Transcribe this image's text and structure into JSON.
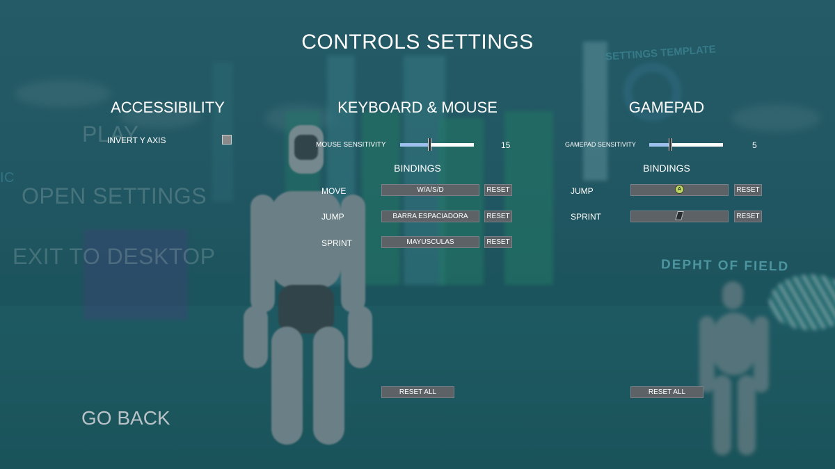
{
  "title": "CONTROLS SETTINGS",
  "background_menu": {
    "play": "PLAY",
    "open_settings": "OPEN SETTINGS",
    "exit": "EXIT TO DESKTOP",
    "depth_of_field": "DEPHT OF FIELD",
    "template_sign": "SETTINGS TEMPLATE",
    "edge_text": "IC"
  },
  "accessibility": {
    "title": "ACCESSIBILITY",
    "invert_y_label": "INVERT Y AXIS",
    "invert_y_checked": false
  },
  "keyboard_mouse": {
    "title": "KEYBOARD & MOUSE",
    "sensitivity_label": "MOUSE SENSITIVITY",
    "sensitivity_value": "15",
    "sensitivity_fraction": 0.4,
    "bindings_title": "BINDINGS",
    "bindings": [
      {
        "action": "MOVE",
        "key": "W/A/S/D",
        "reset": "RESET"
      },
      {
        "action": "JUMP",
        "key": "BARRA ESPACIADORA",
        "reset": "RESET"
      },
      {
        "action": "SPRINT",
        "key": "MAYUSCULAS",
        "reset": "RESET"
      }
    ],
    "reset_all": "RESET ALL"
  },
  "gamepad": {
    "title": "GAMEPAD",
    "sensitivity_label": "GAMEPAD SENSITIVITY",
    "sensitivity_value": "5",
    "sensitivity_fraction": 0.28,
    "bindings_title": "BINDINGS",
    "bindings": [
      {
        "action": "JUMP",
        "icon": "gamepad-a-button-icon",
        "icon_letter": "A",
        "reset": "RESET"
      },
      {
        "action": "SPRINT",
        "icon": "gamepad-trigger-icon",
        "reset": "RESET"
      }
    ],
    "reset_all": "RESET ALL"
  },
  "go_back": "GO BACK",
  "colors": {
    "background": "#1d5560",
    "slider_fill": "#9ec0ee",
    "button": "#5c6266"
  }
}
